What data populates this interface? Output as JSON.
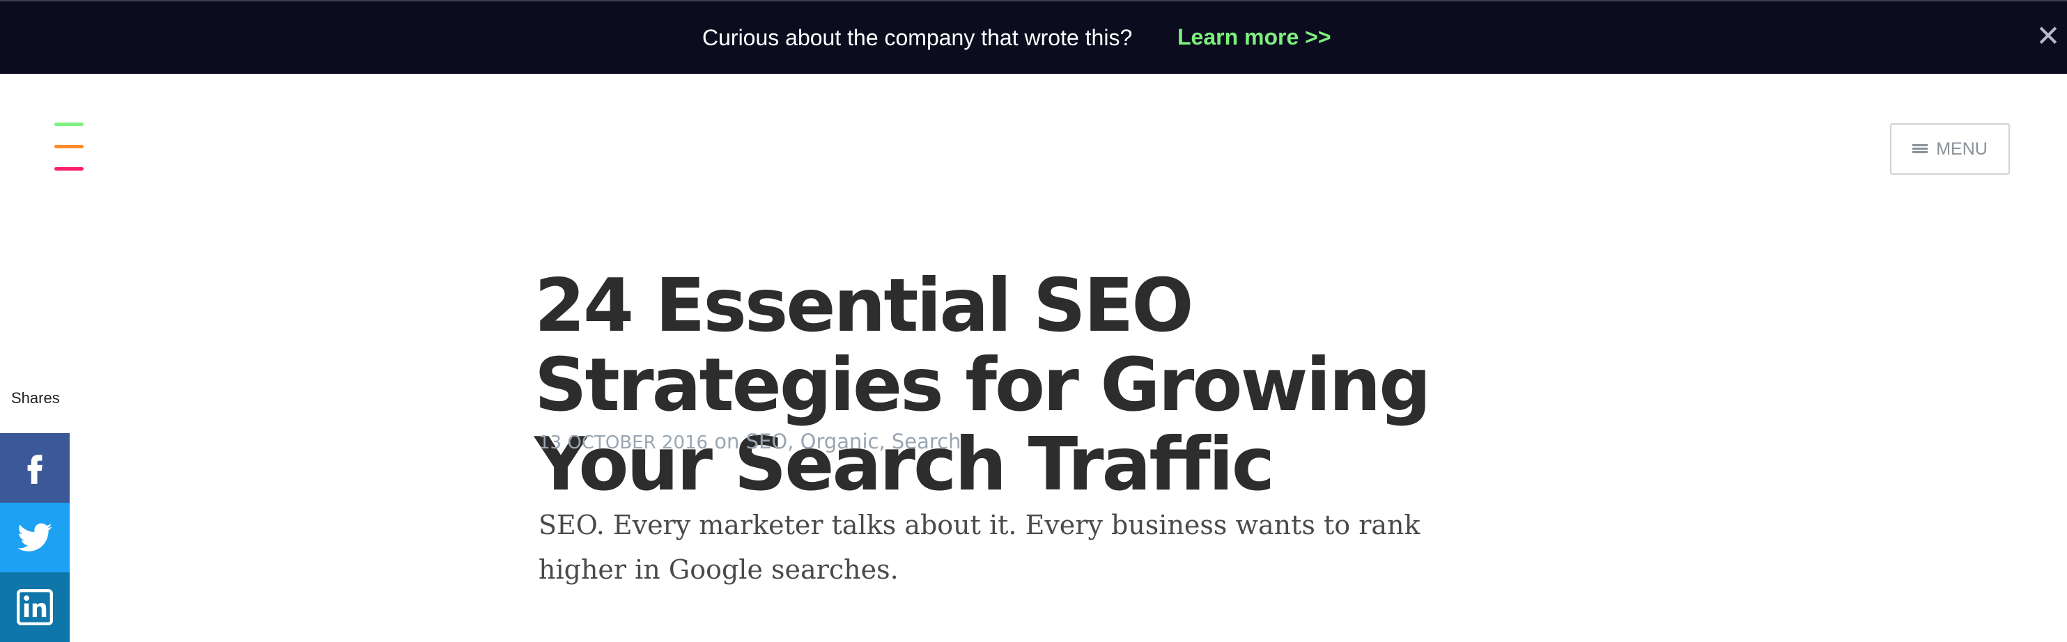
{
  "banner": {
    "text": "Curious about the company that wrote this?",
    "link": "Learn more >>",
    "close": "✕"
  },
  "header": {
    "menu_label": "MENU",
    "logo_colors": [
      "#7ef07e",
      "#ff8a2a",
      "#ff1f6b"
    ]
  },
  "article": {
    "title": "24 Essential SEO Strategies for Growing Your Search Traffic",
    "date": "13 OCTOBER 2016",
    "on": "on",
    "tags": [
      "SEO",
      "Organic",
      "Search"
    ],
    "intro": "SEO. Every marketer talks about it. Every business wants to rank higher in Google searches."
  },
  "share": {
    "label": "Shares",
    "buttons": [
      {
        "network": "facebook",
        "icon": "facebook-icon",
        "color": "#3b5998"
      },
      {
        "network": "twitter",
        "icon": "twitter-icon",
        "color": "#1da1f2"
      },
      {
        "network": "linkedin",
        "icon": "linkedin-icon",
        "color": "#0e76a8"
      }
    ]
  },
  "colors": {
    "banner_bg": "#0b0d1f",
    "banner_link": "#7ef07e",
    "title": "#2d2d2d",
    "meta": "#9aa6b2"
  }
}
